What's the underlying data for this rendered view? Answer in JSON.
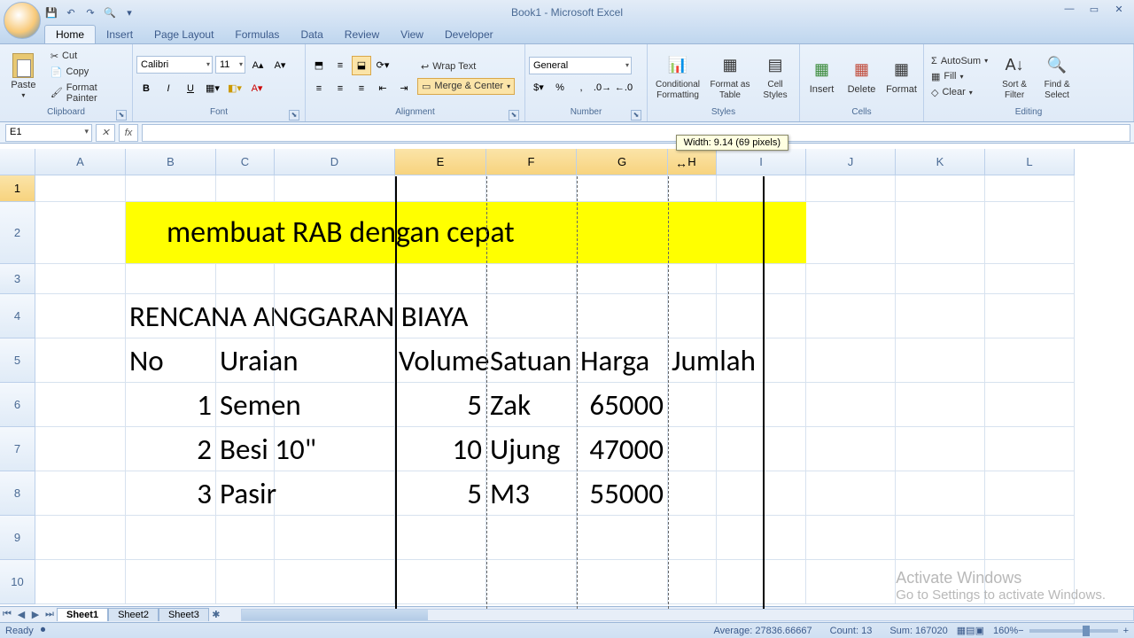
{
  "title": "Book1 - Microsoft Excel",
  "qat": {
    "save": "💾",
    "undo": "↶",
    "redo": "↷",
    "print": "🔍"
  },
  "tabs": [
    "Home",
    "Insert",
    "Page Layout",
    "Formulas",
    "Data",
    "Review",
    "View",
    "Developer"
  ],
  "ribbon": {
    "clipboard": {
      "label": "Clipboard",
      "paste": "Paste",
      "cut": "Cut",
      "copy": "Copy",
      "fmtpainter": "Format Painter"
    },
    "font": {
      "label": "Font",
      "name": "Calibri",
      "size": "11"
    },
    "alignment": {
      "label": "Alignment",
      "wrap": "Wrap Text",
      "merge": "Merge & Center"
    },
    "number": {
      "label": "Number",
      "format": "General"
    },
    "styles": {
      "label": "Styles",
      "cond": "Conditional Formatting",
      "table": "Format as Table",
      "cell": "Cell Styles"
    },
    "cells": {
      "label": "Cells",
      "insert": "Insert",
      "delete": "Delete",
      "format": "Format"
    },
    "editing": {
      "label": "Editing",
      "autosum": "AutoSum",
      "fill": "Fill",
      "clear": "Clear",
      "sort": "Sort & Filter",
      "find": "Find & Select"
    }
  },
  "namebox": "E1",
  "width_tip": "Width: 9.14 (69 pixels)",
  "columns": [
    "A",
    "B",
    "C",
    "D",
    "E",
    "F",
    "G",
    "H",
    "I",
    "J",
    "K",
    "L"
  ],
  "rows": [
    "1",
    "2",
    "3",
    "4",
    "5",
    "6",
    "7",
    "8",
    "9",
    "10"
  ],
  "cells": {
    "title2": "membuat RAB dengan cepat",
    "h4": "RENCANA ANGGARAN BIAYA",
    "h5": {
      "no": "No",
      "uraian": "Uraian",
      "vol": "Volume",
      "sat": "Satuan",
      "harga": "Harga",
      "jum": "Jumlah"
    },
    "r6": {
      "no": "1",
      "uraian": "Semen",
      "vol": "5",
      "sat": "Zak",
      "harga": "65000"
    },
    "r7": {
      "no": "2",
      "uraian": "Besi 10\"",
      "vol": "10",
      "sat": "Ujung",
      "harga": "47000"
    },
    "r8": {
      "no": "3",
      "uraian": "Pasir",
      "vol": "5",
      "sat": "M3",
      "harga": "55000"
    }
  },
  "sheets": [
    "Sheet1",
    "Sheet2",
    "Sheet3"
  ],
  "status": {
    "ready": "Ready",
    "avg": "Average: 27836.66667",
    "count": "Count: 13",
    "sum": "Sum: 167020",
    "zoom": "160%"
  },
  "watermark": {
    "l1": "Activate Windows",
    "l2": "Go to Settings to activate Windows."
  }
}
